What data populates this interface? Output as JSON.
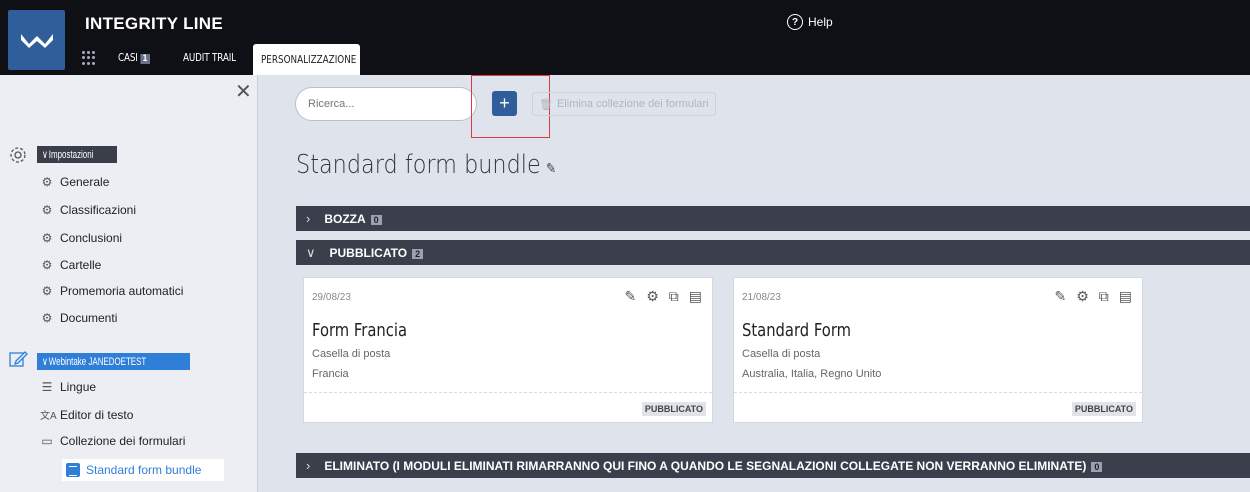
{
  "app": {
    "brand": "INTEGRITY LINE",
    "help": "Help"
  },
  "nav": {
    "cases_label": "CASI",
    "cases_count": "1",
    "audit_label": "AUDIT TRAIL",
    "active_tab": "PERSONALIZZAZIONE"
  },
  "sidebar": {
    "settings_header": "Impostazioni",
    "settings_items": [
      {
        "label": "Generale",
        "icon": "gear-icon"
      },
      {
        "label": "Classificazioni",
        "icon": "gear-icon"
      },
      {
        "label": "Conclusioni",
        "icon": "gear-icon"
      },
      {
        "label": "Cartelle",
        "icon": "gear-icon"
      },
      {
        "label": "Promemoria automatici",
        "icon": "gear-icon"
      },
      {
        "label": "Documenti",
        "icon": "gear-icon"
      }
    ],
    "intake_header": "Webintake JANEDOETEST",
    "intake_items": [
      {
        "label": "Lingue",
        "icon": "list-icon"
      },
      {
        "label": "Editor di testo",
        "icon": "translate-icon"
      },
      {
        "label": "Collezione dei formulari",
        "icon": "folder-icon"
      }
    ],
    "selected_item": "Standard form bundle"
  },
  "toolbar": {
    "search_placeholder": "Ricerca...",
    "add_label": "+",
    "delete_label": "Elimina collezione dei formulari"
  },
  "page": {
    "title": "Standard form bundle"
  },
  "sections": {
    "draft": {
      "label": "BOZZA",
      "count": "0"
    },
    "published": {
      "label": "PUBBLICATO",
      "count": "2"
    },
    "deleted": {
      "label": "ELIMINATO (I MODULI ELIMINATI RIMARRANNO QUI FINO A QUANDO LE SEGNALAZIONI COLLEGATE NON VERRANNO ELIMINATE)",
      "count": "0"
    }
  },
  "cards": [
    {
      "date": "29/08/23",
      "name": "Form Francia",
      "channel": "Casella di posta",
      "countries": "Francia",
      "status": "PUBBLICATO"
    },
    {
      "date": "21/08/23",
      "name": "Standard Form",
      "channel": "Casella di posta",
      "countries": "Australia, Italia, Regno Unito",
      "status": "PUBBLICATO"
    }
  ],
  "colors": {
    "accent": "#2f7fd8",
    "brand": "#2f5e9a",
    "dark": "#0e1016",
    "section": "#3b3f4c",
    "highlight": "#e0393e"
  }
}
